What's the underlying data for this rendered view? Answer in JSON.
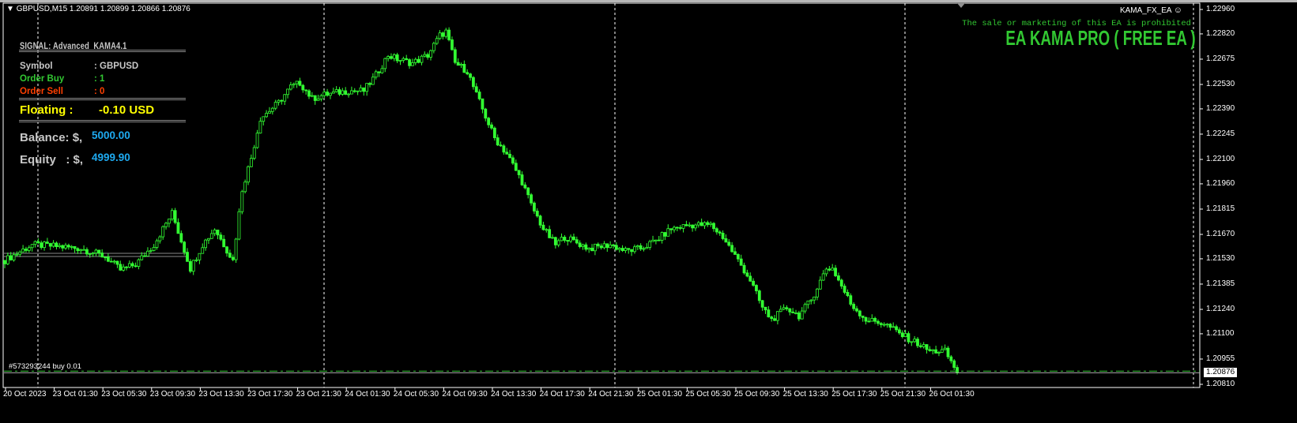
{
  "header": {
    "symbol_info": "GBPUSD,M15  1.20891 1.20899 1.20866 1.20876"
  },
  "panel": {
    "signal_title": "SIGNAL: Advanced_KAMA4.1",
    "symbol_label": "Symbol",
    "symbol_value": ": GBPUSD",
    "buy_label": "Order Buy",
    "buy_value": ": 1",
    "sell_label": "Order Sell",
    "sell_value": ": 0",
    "floating_label": "Floating :",
    "floating_value": "-0.10 USD",
    "balance_label": "Balance: $,",
    "balance_value": "5000.00",
    "equity_label": "Equity   : $,",
    "equity_value": "4999.90"
  },
  "ea": {
    "name": "KAMA_FX_EA",
    "notice": "The sale or marketing of this EA is prohibited",
    "banner": "EA KAMA PRO ( FREE EA )"
  },
  "order_label": "#573293244 buy 0.01",
  "colors": {
    "candle": "#32ff32",
    "banner": "#32c832",
    "notice": "#32c832",
    "buy": "#32c832",
    "sell": "#ff4000",
    "floating": "#ffff00",
    "money": "#1eaaf0"
  },
  "chart_data": {
    "type": "candlestick",
    "symbol": "GBPUSD",
    "timeframe": "M15",
    "price_axis": [
      "1.22960",
      "1.22820",
      "1.22675",
      "1.22530",
      "1.22390",
      "1.22245",
      "1.22100",
      "1.21960",
      "1.21815",
      "1.21670",
      "1.21530",
      "1.21385",
      "1.21240",
      "1.21100",
      "1.20955",
      "1.20810"
    ],
    "ylim": [
      1.2081,
      1.2296
    ],
    "current_price": "1.20876",
    "order_price": 1.20886,
    "time_axis": [
      "20 Oct 2023",
      "23 Oct 01:30",
      "23 Oct 05:30",
      "23 Oct 09:30",
      "23 Oct 13:30",
      "23 Oct 17:30",
      "23 Oct 21:30",
      "24 Oct 01:30",
      "24 Oct 05:30",
      "24 Oct 09:30",
      "24 Oct 13:30",
      "24 Oct 17:30",
      "24 Oct 21:30",
      "25 Oct 01:30",
      "25 Oct 05:30",
      "25 Oct 09:30",
      "25 Oct 13:30",
      "25 Oct 17:30",
      "25 Oct 21:30",
      "26 Oct 01:30"
    ],
    "candle_count": 314,
    "close_waypoints": [
      [
        0,
        1.21521
      ],
      [
        9,
        1.21611
      ],
      [
        17,
        1.21602
      ],
      [
        25,
        1.21589
      ],
      [
        33,
        1.21543
      ],
      [
        38,
        1.21466
      ],
      [
        43,
        1.21498
      ],
      [
        49,
        1.21611
      ],
      [
        55,
        1.21792
      ],
      [
        61,
        1.21475
      ],
      [
        65,
        1.21611
      ],
      [
        69,
        1.21702
      ],
      [
        75,
        1.21521
      ],
      [
        78,
        1.21928
      ],
      [
        81,
        1.22109
      ],
      [
        84,
        1.22335
      ],
      [
        90,
        1.22426
      ],
      [
        94,
        1.22516
      ],
      [
        97,
        1.22539
      ],
      [
        101,
        1.22449
      ],
      [
        105,
        1.22471
      ],
      [
        113,
        1.22494
      ],
      [
        118,
        1.22494
      ],
      [
        122,
        1.22584
      ],
      [
        126,
        1.22698
      ],
      [
        129,
        1.22675
      ],
      [
        134,
        1.22652
      ],
      [
        139,
        1.22698
      ],
      [
        143,
        1.22811
      ],
      [
        145,
        1.22833
      ],
      [
        148,
        1.22652
      ],
      [
        152,
        1.22607
      ],
      [
        155,
        1.22471
      ],
      [
        161,
        1.22222
      ],
      [
        165,
        1.22132
      ],
      [
        170,
        1.21973
      ],
      [
        173,
        1.21838
      ],
      [
        177,
        1.21702
      ],
      [
        181,
        1.21611
      ],
      [
        184,
        1.21656
      ],
      [
        192,
        1.21589
      ],
      [
        199,
        1.21611
      ],
      [
        204,
        1.21575
      ],
      [
        209,
        1.21589
      ],
      [
        214,
        1.21634
      ],
      [
        219,
        1.21702
      ],
      [
        225,
        1.21724
      ],
      [
        232,
        1.21724
      ],
      [
        236,
        1.21656
      ],
      [
        241,
        1.21521
      ],
      [
        245,
        1.21408
      ],
      [
        249,
        1.21249
      ],
      [
        252,
        1.21181
      ],
      [
        257,
        1.21249
      ],
      [
        261,
        1.21204
      ],
      [
        265,
        1.21294
      ],
      [
        270,
        1.21475
      ],
      [
        272,
        1.21475
      ],
      [
        278,
        1.21272
      ],
      [
        283,
        1.21181
      ],
      [
        289,
        1.21159
      ],
      [
        295,
        1.21091
      ],
      [
        300,
        1.21045
      ],
      [
        304,
        1.21
      ],
      [
        309,
        1.21
      ],
      [
        312,
        1.2091
      ],
      [
        313,
        1.20876
      ]
    ]
  }
}
